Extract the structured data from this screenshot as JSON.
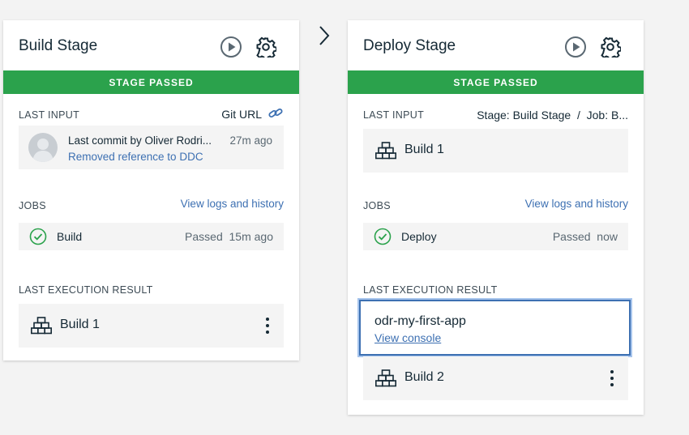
{
  "colors": {
    "passed": "#2ba24c",
    "link": "#3d70b2",
    "tile_bg": "#f4f4f4"
  },
  "stages": [
    {
      "title": "Build Stage",
      "status": "STAGE PASSED",
      "last_input": {
        "label": "LAST INPUT",
        "source": "Git URL",
        "source_icon": "link-icon",
        "commit_text": "Last commit by Oliver Rodri...",
        "commit_time": "27m ago",
        "commit_message": "Removed reference to DDC"
      },
      "jobs": {
        "label": "JOBS",
        "link": "View logs and history",
        "items": [
          {
            "name": "Build",
            "status": "Passed  15m ago",
            "icon": "check-circle-icon"
          }
        ]
      },
      "last_result": {
        "label": "LAST EXECUTION RESULT",
        "builds": [
          {
            "name": "Build 1",
            "icon": "blocks-icon"
          }
        ]
      }
    },
    {
      "title": "Deploy Stage",
      "status": "STAGE PASSED",
      "last_input": {
        "label": "LAST INPUT",
        "source": "Stage: Build Stage  /  Job: B...",
        "build_name": "Build 1"
      },
      "jobs": {
        "label": "JOBS",
        "link": "View logs and history",
        "items": [
          {
            "name": "Deploy",
            "status": "Passed  now",
            "icon": "check-circle-icon"
          }
        ]
      },
      "last_result": {
        "label": "LAST EXECUTION RESULT",
        "popup": {
          "name": "odr-my-first-app",
          "link": "View console"
        },
        "builds": [
          {
            "name": "Build 2",
            "icon": "blocks-icon"
          }
        ]
      }
    }
  ]
}
